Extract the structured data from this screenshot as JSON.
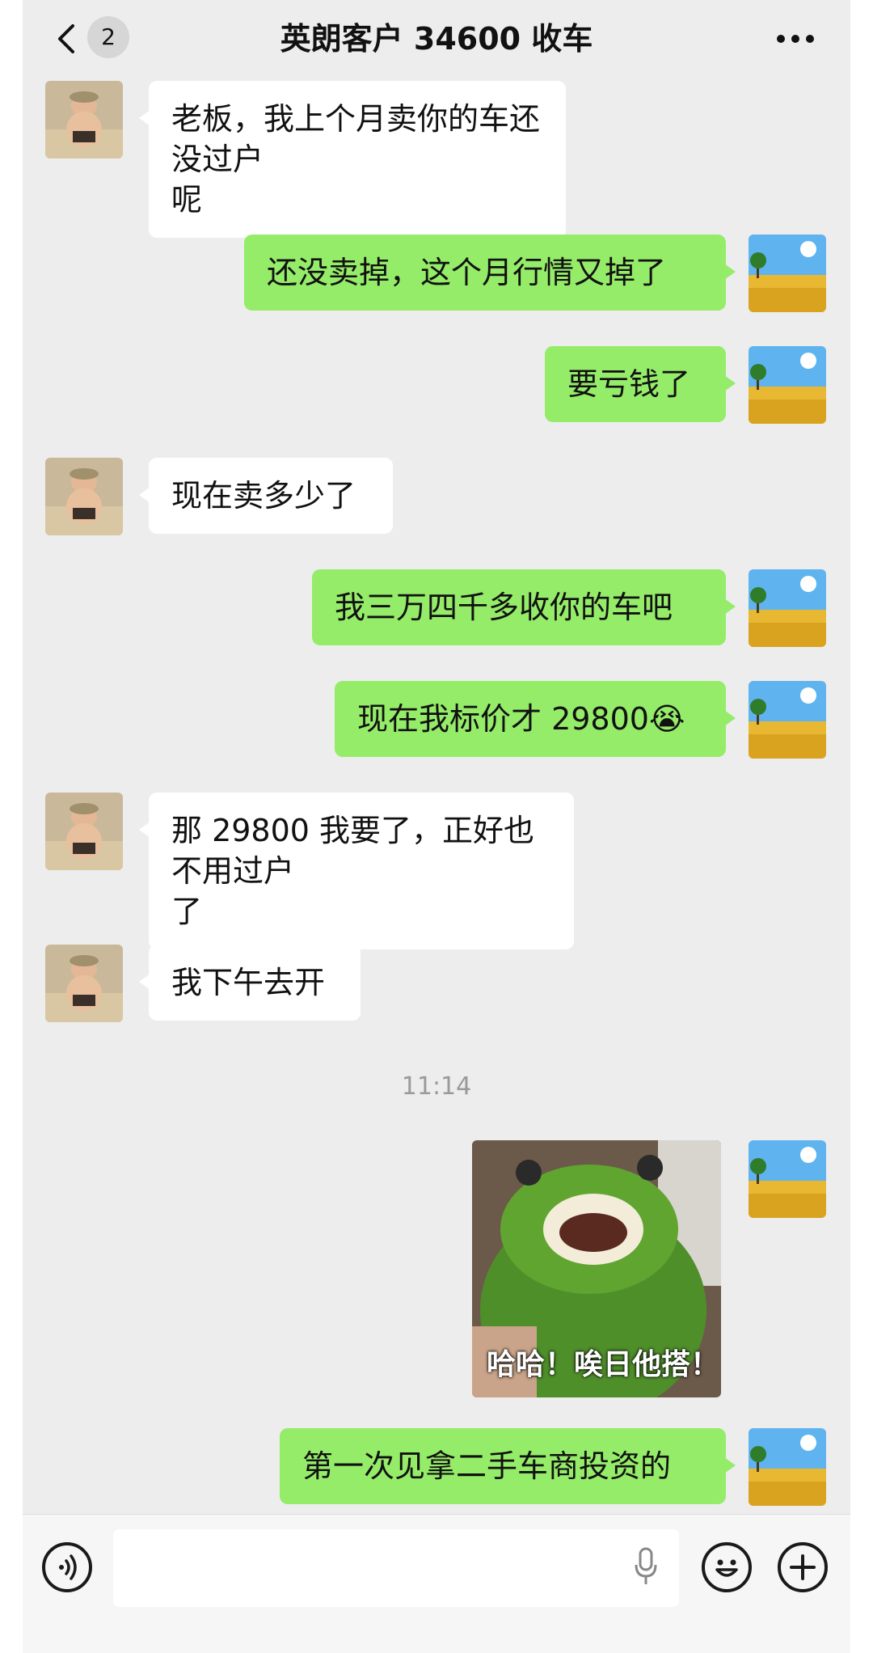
{
  "header": {
    "title": "英朗客户 34600 收车",
    "unread_count": "2"
  },
  "messages": [
    {
      "side": "in",
      "text": "老板，我上个月卖你的车还没过户\n呢"
    },
    {
      "side": "out",
      "text": "还没卖掉，这个月行情又掉了"
    },
    {
      "side": "out",
      "text": "要亏钱了"
    },
    {
      "side": "in",
      "text": "现在卖多少了"
    },
    {
      "side": "out",
      "text": "我三万四千多收你的车吧"
    },
    {
      "side": "out",
      "text": "现在我标价才 29800😭"
    },
    {
      "side": "in",
      "text": "那 29800 我要了，正好也不用过户\n了"
    },
    {
      "side": "in",
      "text": "我下午去开"
    },
    {
      "side": "out",
      "text": "第一次见拿二手车商投资的"
    }
  ],
  "timestamp": "11:14",
  "sticker": {
    "caption": "哈哈！唉日他搭！"
  },
  "icons": {
    "voice": "voice-icon",
    "mic": "microphone-icon",
    "emoji": "emoji-icon",
    "plus": "plus-icon",
    "back": "chevron-left-icon",
    "more": "more-dots-icon"
  },
  "colors": {
    "outgoing_bubble": "#95ec69",
    "incoming_bubble": "#ffffff",
    "background": "#ededed"
  }
}
